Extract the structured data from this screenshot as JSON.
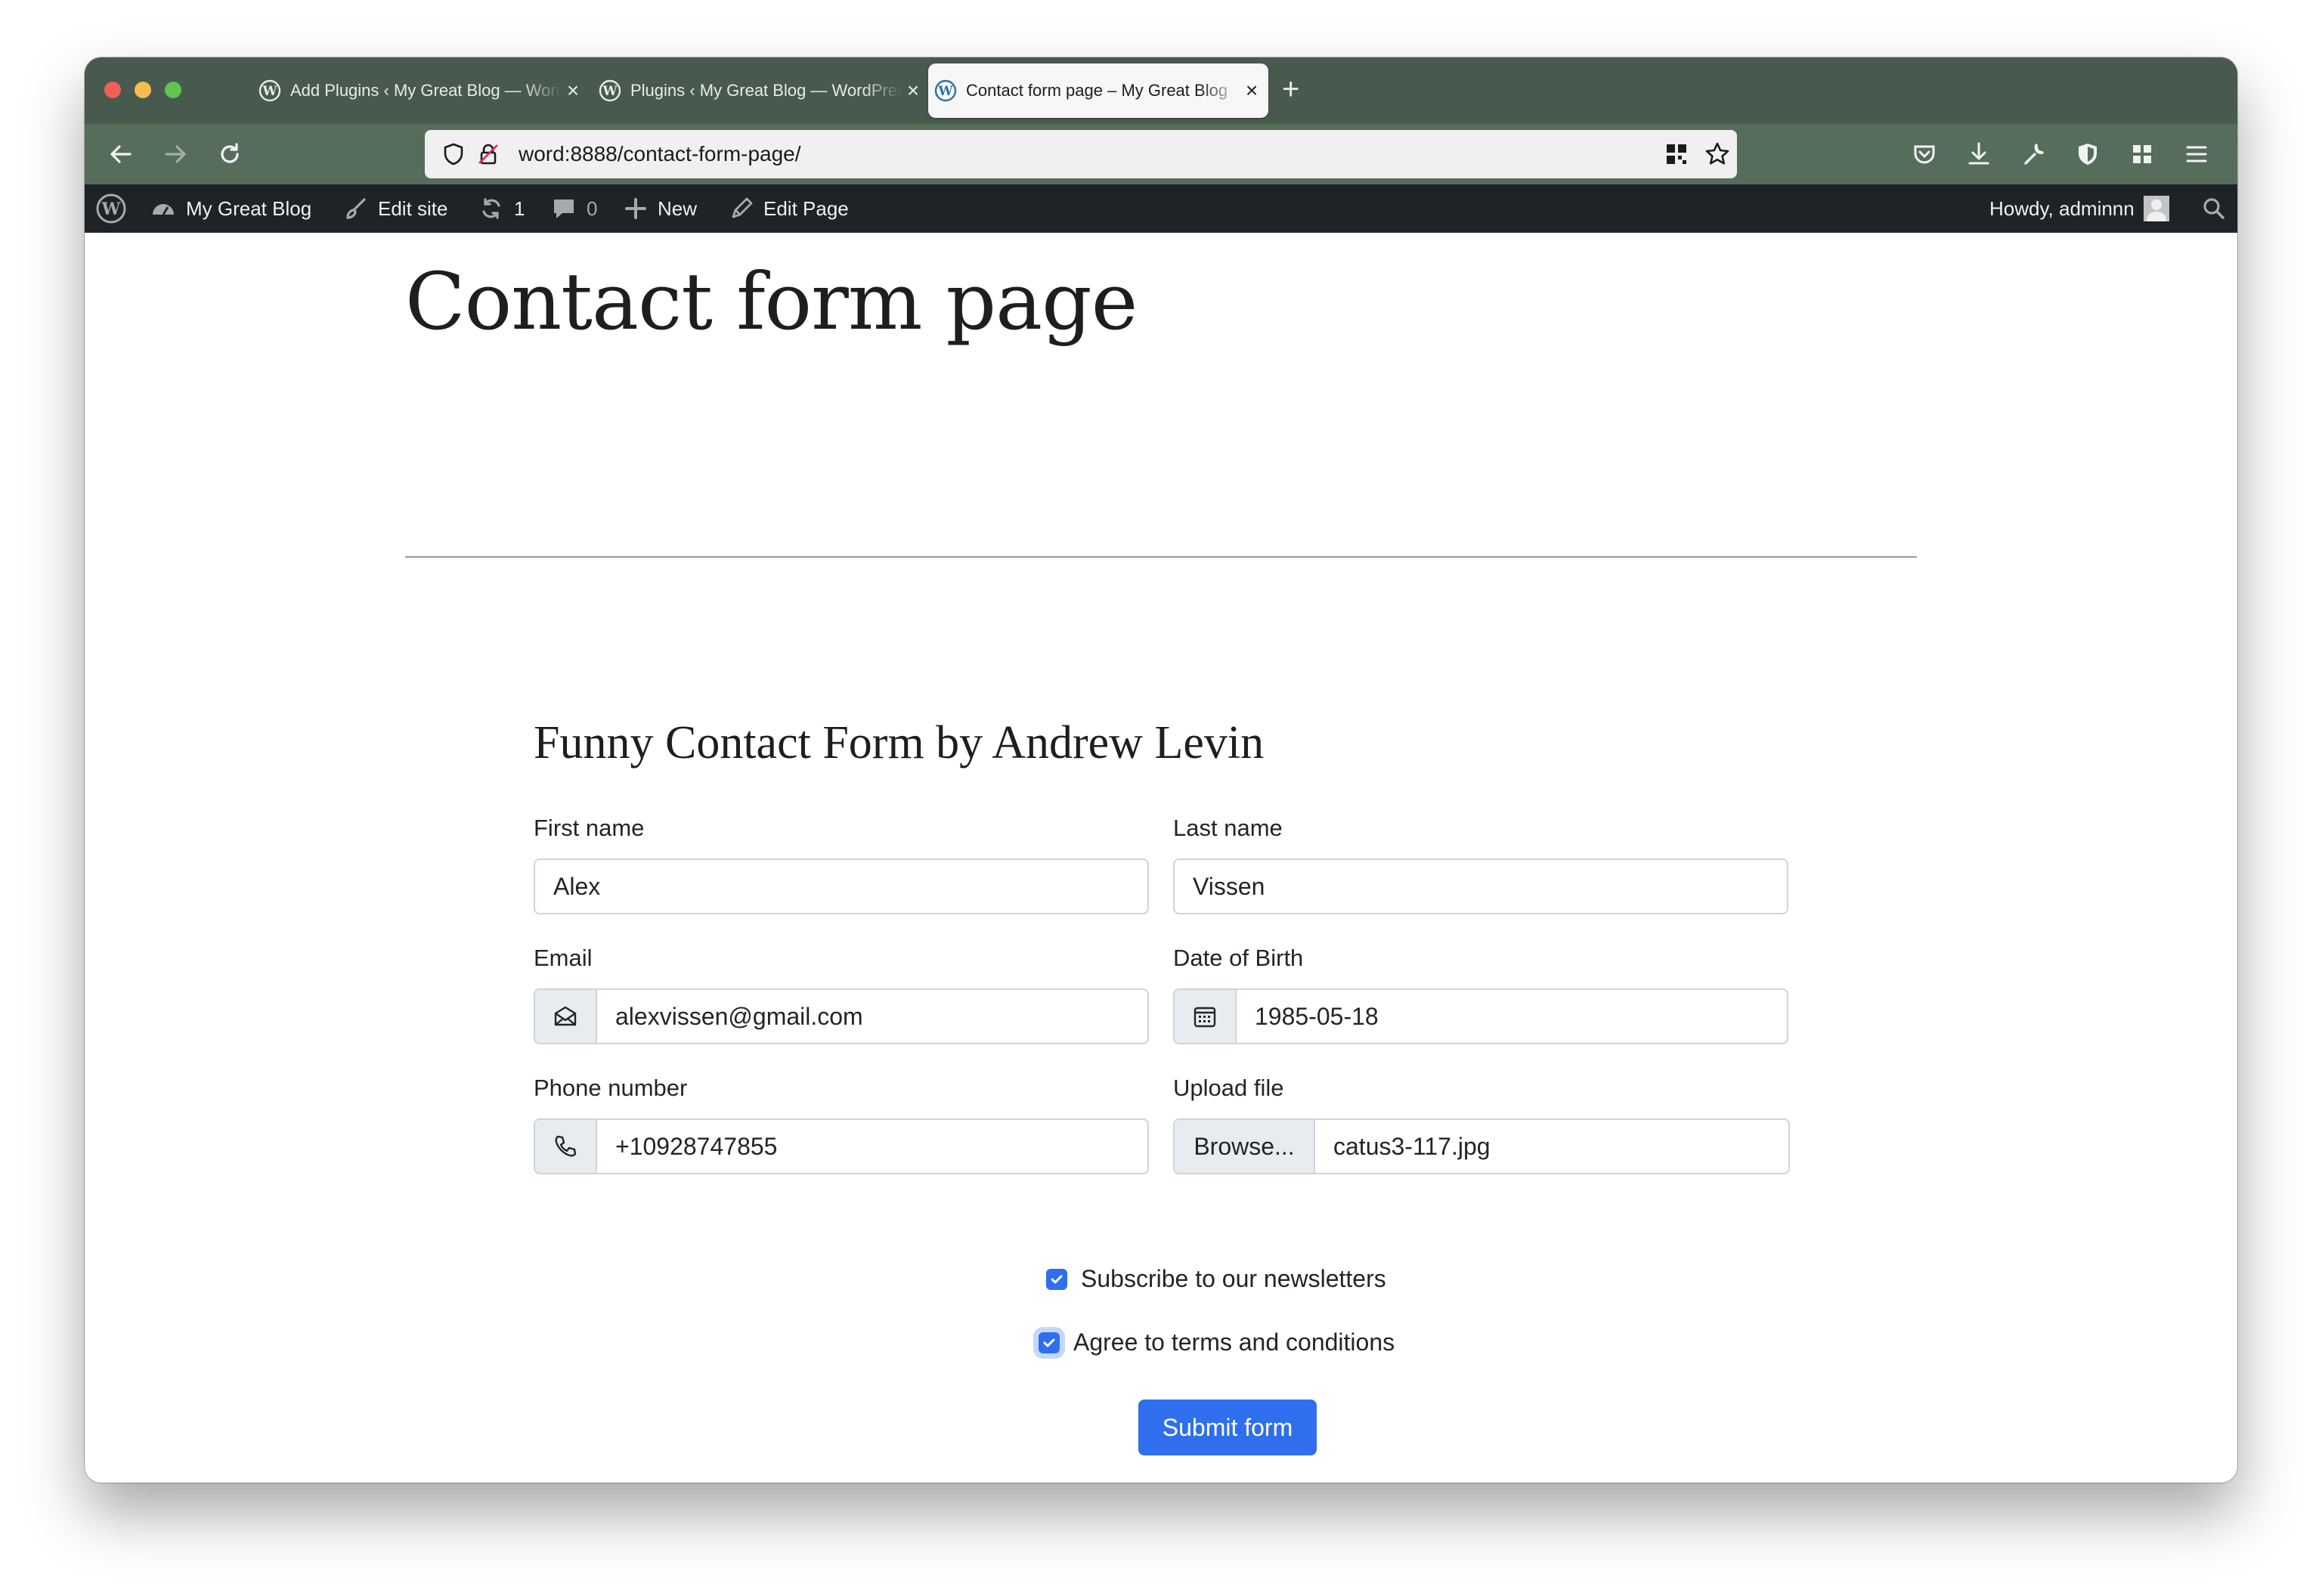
{
  "browser": {
    "tabs": [
      {
        "title": "Add Plugins ‹ My Great Blog — WordPress",
        "active": false
      },
      {
        "title": "Plugins ‹ My Great Blog — WordPress",
        "active": false
      },
      {
        "title": "Contact form page – My Great Blog",
        "active": true
      }
    ],
    "url": "word:8888/contact-form-page/"
  },
  "adminbar": {
    "site_name": "My Great Blog",
    "edit_site": "Edit site",
    "updates_count": "1",
    "comments_count": "0",
    "new_label": "New",
    "edit_page": "Edit Page",
    "greeting": "Howdy, adminnn"
  },
  "page": {
    "title": "Contact form page"
  },
  "form": {
    "title": "Funny Contact Form by Andrew Levin",
    "first_name": {
      "label": "First name",
      "value": "Alex"
    },
    "last_name": {
      "label": "Last name",
      "value": "Vissen"
    },
    "email": {
      "label": "Email",
      "value": "alexvissen@gmail.com"
    },
    "dob": {
      "label": "Date of Birth",
      "value": "1985-05-18"
    },
    "phone": {
      "label": "Phone number",
      "value": "+10928747855"
    },
    "upload": {
      "label": "Upload file",
      "browse_label": "Browse...",
      "file_name": "catus3-117.jpg"
    },
    "newsletter": {
      "label": "Subscribe to our newsletters",
      "checked": true
    },
    "terms": {
      "label": "Agree to terms and conditions",
      "checked": true
    },
    "submit_label": "Submit form"
  },
  "colors": {
    "titlebar": "#485a4d",
    "navbar": "#576d5c",
    "adminbar": "#1d2327",
    "accent": "#2f6fed"
  }
}
